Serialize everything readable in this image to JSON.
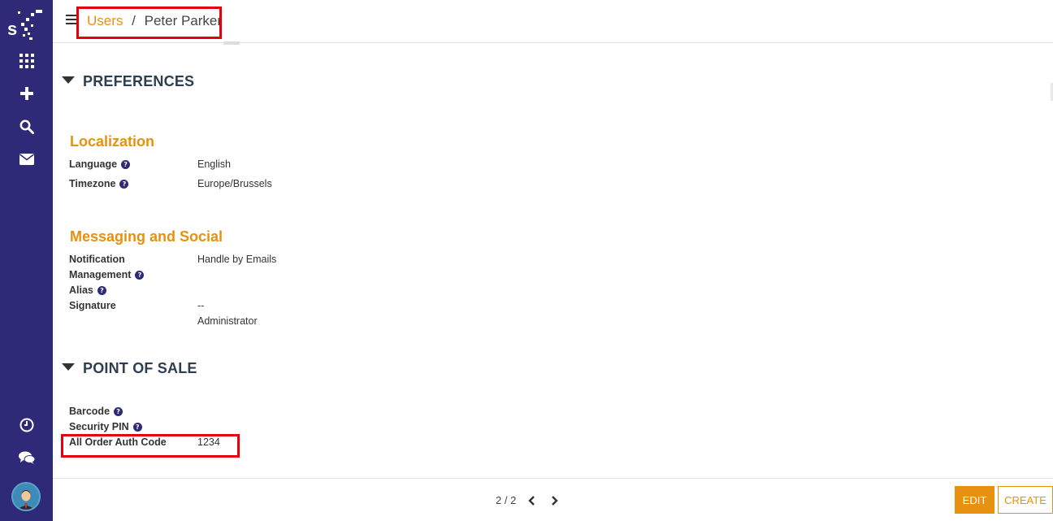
{
  "colors": {
    "sidebar": "#2e2a78",
    "accent": "#e8900f",
    "highlight": "#e3000f"
  },
  "sidebar": {
    "items": [
      {
        "icon": "apps-grid-icon"
      },
      {
        "icon": "plus-icon"
      },
      {
        "icon": "search-icon"
      },
      {
        "icon": "envelope-icon"
      },
      {
        "icon": "clock-icon"
      },
      {
        "icon": "chat-icon"
      }
    ]
  },
  "breadcrumb": {
    "parent": "Users",
    "separator": "/",
    "current": "Peter Parker"
  },
  "preferences": {
    "title": "PREFERENCES",
    "localization": {
      "title": "Localization",
      "language_label": "Language",
      "language_value": "English",
      "timezone_label": "Timezone",
      "timezone_value": "Europe/Brussels"
    },
    "messaging": {
      "title": "Messaging and Social",
      "notification_label_1": "Notification",
      "notification_label_2": "Management",
      "notification_value": "Handle by Emails",
      "alias_label": "Alias",
      "signature_label": "Signature",
      "signature_line1": "--",
      "signature_line2": "Administrator"
    }
  },
  "pos": {
    "title": "POINT OF SALE",
    "barcode_label": "Barcode",
    "pin_label": "Security PIN",
    "auth_label": "All Order Auth Code",
    "auth_value": "1234"
  },
  "help_glyph": "?",
  "pager": {
    "text": "2 / 2"
  },
  "buttons": {
    "edit": "EDIT",
    "create": "CREATE"
  }
}
